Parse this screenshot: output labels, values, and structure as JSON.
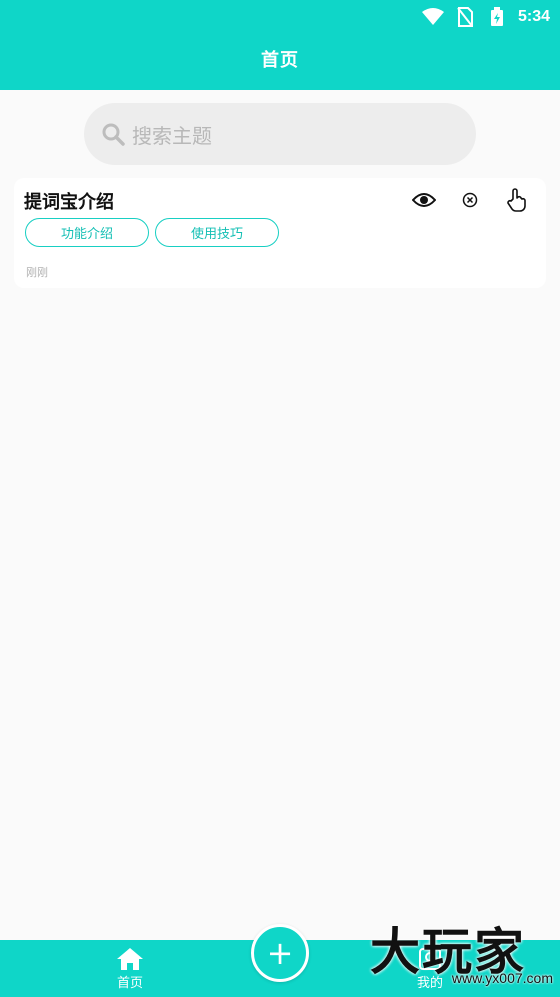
{
  "status_bar": {
    "time": "5:34",
    "icons": [
      "wifi-icon",
      "no-sim-icon",
      "battery-charging-icon"
    ]
  },
  "header": {
    "title": "首页"
  },
  "search": {
    "placeholder": "搜索主题",
    "icon": "search-icon"
  },
  "cards": [
    {
      "title": "提词宝介绍",
      "actions": [
        "eye-icon",
        "close-circle-icon",
        "hand-pointer-icon"
      ],
      "tags": [
        "功能介绍",
        "使用技巧"
      ],
      "time": "刚刚"
    }
  ],
  "bottom_nav": {
    "home_label": "首页",
    "add_label": "+",
    "mine_label": "我的"
  },
  "watermark": {
    "text": "大玩家",
    "site": "www.yx007.com"
  },
  "colors": {
    "accent": "#0fd6c8",
    "tag_border": "#18cfc3",
    "background": "#fafafa"
  }
}
